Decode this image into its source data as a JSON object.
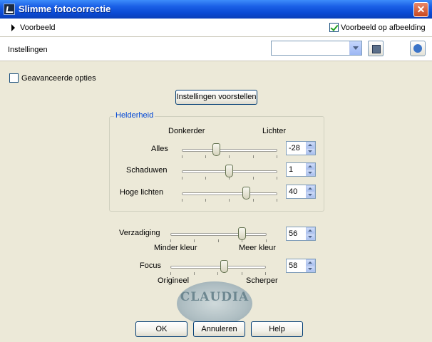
{
  "window": {
    "title": "Slimme fotocorrectie",
    "close_glyph": "✕"
  },
  "preview": {
    "label": "Voorbeeld",
    "on_image_label": "Voorbeeld op afbeelding",
    "on_image_checked": true
  },
  "settings": {
    "label": "Instellingen",
    "preset_value": ""
  },
  "advanced": {
    "label": "Geavanceerde opties",
    "checked": false
  },
  "suggest_button": "Instellingen voorstellen",
  "brightness": {
    "legend": "Helderheid",
    "left_label": "Donkerder",
    "right_label": "Lichter",
    "rows": [
      {
        "label": "Alles",
        "value": "-28"
      },
      {
        "label": "Schaduwen",
        "value": "1"
      },
      {
        "label": "Hoge lichten",
        "value": "40"
      }
    ]
  },
  "saturation": {
    "label": "Verzadiging",
    "value": "56",
    "min_label": "Minder kleur",
    "max_label": "Meer kleur"
  },
  "focus": {
    "label": "Focus",
    "value": "58",
    "min_label": "Origineel",
    "max_label": "Scherper"
  },
  "buttons": {
    "ok": "OK",
    "cancel": "Annuleren",
    "help": "Help"
  },
  "watermark": {
    "text": "CLAUDIA"
  },
  "icons": {
    "app": "photo-app-icon",
    "close": "close-icon",
    "expand": "triangle-right-icon",
    "dropdown": "chevron-down-icon",
    "save": "save-disk-icon",
    "reset": "reset-icon"
  },
  "colors": {
    "title_bar": "#0a4ad4",
    "group_legend": "#0046d5",
    "checkmark": "#21a121"
  }
}
